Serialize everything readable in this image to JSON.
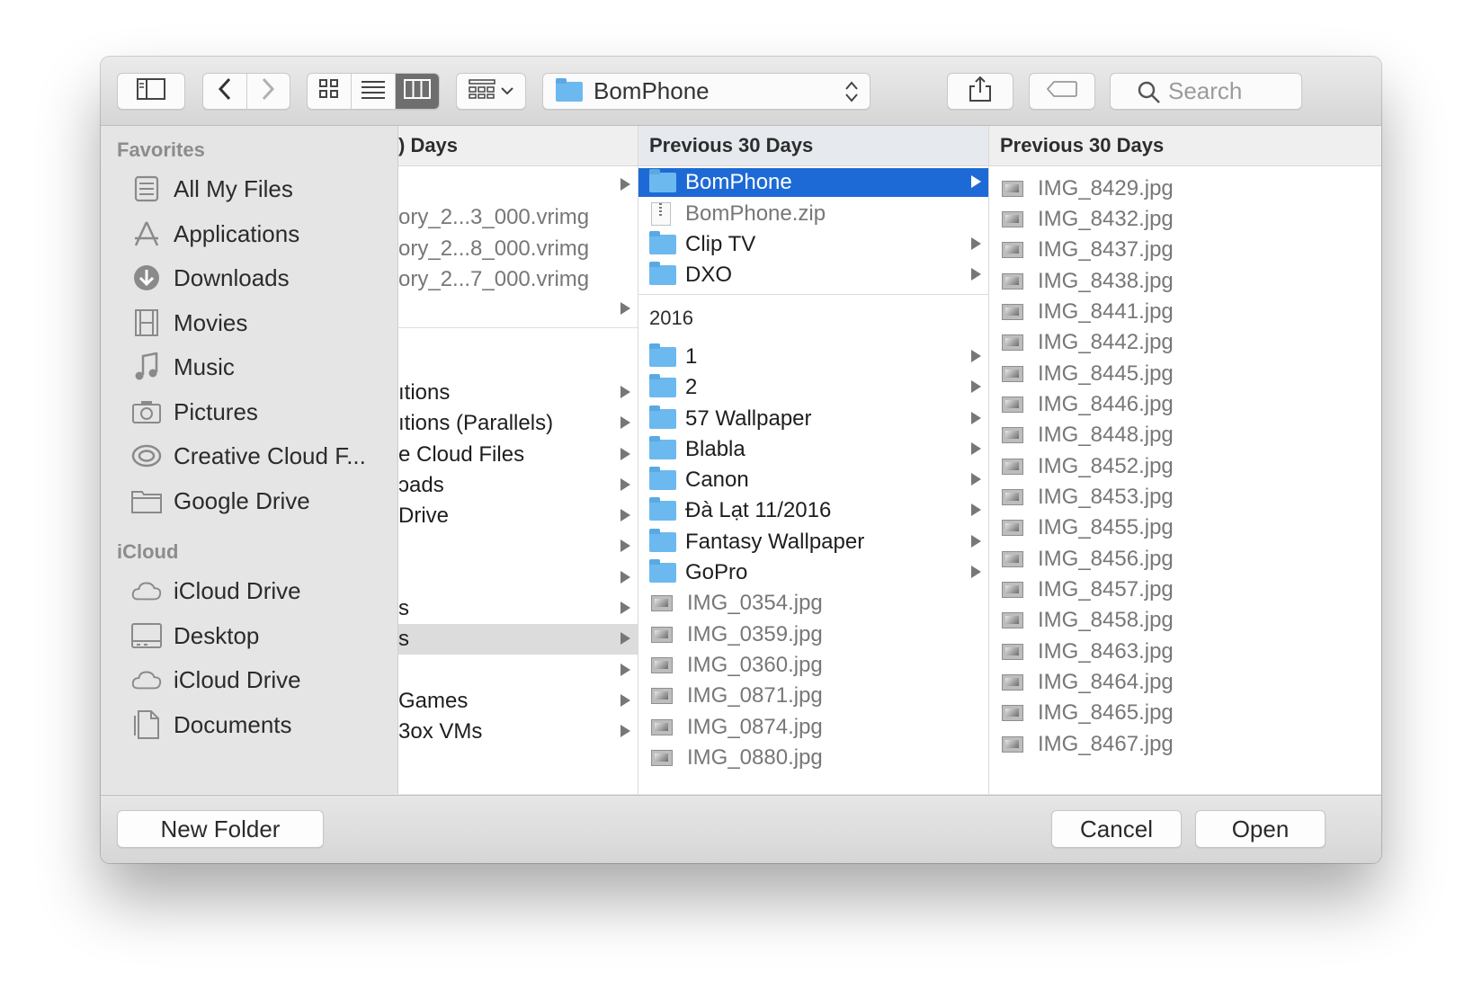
{
  "toolbar": {
    "location": "BomPhone",
    "search_placeholder": "Search"
  },
  "sidebar": {
    "favorites_heading": "Favorites",
    "favorites": [
      {
        "label": "All My Files",
        "icon": "all-files-icon"
      },
      {
        "label": "Applications",
        "icon": "applications-icon"
      },
      {
        "label": "Downloads",
        "icon": "downloads-icon"
      },
      {
        "label": "Movies",
        "icon": "movies-icon"
      },
      {
        "label": "Music",
        "icon": "music-icon"
      },
      {
        "label": "Pictures",
        "icon": "pictures-icon"
      },
      {
        "label": "Creative Cloud F...",
        "icon": "creative-cloud-icon"
      },
      {
        "label": "Google Drive",
        "icon": "folder-icon"
      }
    ],
    "icloud_heading": "iCloud",
    "icloud": [
      {
        "label": "iCloud Drive",
        "icon": "cloud-icon"
      },
      {
        "label": "Desktop",
        "icon": "desktop-icon"
      },
      {
        "label": "iCloud Drive",
        "icon": "cloud-icon"
      },
      {
        "label": "Documents",
        "icon": "documents-icon"
      }
    ]
  },
  "column1": {
    "header": ") Days",
    "items": [
      {
        "label": "",
        "arrow": true
      },
      {
        "label": "ory_2...3_000.vrimg",
        "arrow": false
      },
      {
        "label": "ory_2...8_000.vrimg",
        "arrow": false
      },
      {
        "label": "ory_2...7_000.vrimg",
        "arrow": false
      },
      {
        "label": "",
        "arrow": true
      },
      {
        "label": "ıtions",
        "arrow": true
      },
      {
        "label": "ıtions (Parallels)",
        "arrow": true
      },
      {
        "label": "e Cloud Files",
        "arrow": true
      },
      {
        "label": "ɔads",
        "arrow": true
      },
      {
        "label": " Drive",
        "arrow": true
      },
      {
        "label": "",
        "arrow": true
      },
      {
        "label": "",
        "arrow": true
      },
      {
        "label": "s",
        "arrow": true
      },
      {
        "label": "s",
        "arrow": true
      },
      {
        "label": "",
        "arrow": true
      },
      {
        "label": "Games",
        "arrow": true
      },
      {
        "label": "3ox VMs",
        "arrow": true
      }
    ]
  },
  "column2": {
    "header": "Previous 30 Days",
    "recent": [
      {
        "label": "BomPhone",
        "type": "folder",
        "selected": true
      },
      {
        "label": "BomPhone.zip",
        "type": "zip"
      },
      {
        "label": "Clip TV",
        "type": "folder"
      },
      {
        "label": "DXO",
        "type": "folder"
      }
    ],
    "section2_header": "2016",
    "items2016": [
      {
        "label": "1",
        "type": "folder"
      },
      {
        "label": "2",
        "type": "folder"
      },
      {
        "label": "57 Wallpaper",
        "type": "folder"
      },
      {
        "label": "Blabla",
        "type": "folder"
      },
      {
        "label": "Canon",
        "type": "folder"
      },
      {
        "label": "Đà Lạt 11/2016",
        "type": "folder"
      },
      {
        "label": "Fantasy Wallpaper",
        "type": "folder"
      },
      {
        "label": "GoPro",
        "type": "folder"
      },
      {
        "label": "IMG_0354.jpg",
        "type": "image"
      },
      {
        "label": "IMG_0359.jpg",
        "type": "image"
      },
      {
        "label": "IMG_0360.jpg",
        "type": "image"
      },
      {
        "label": "IMG_0871.jpg",
        "type": "image"
      },
      {
        "label": "IMG_0874.jpg",
        "type": "image"
      },
      {
        "label": "IMG_0880.jpg",
        "type": "image"
      }
    ]
  },
  "column3": {
    "header": "Previous 30 Days",
    "items": [
      "IMG_8429.jpg",
      "IMG_8432.jpg",
      "IMG_8437.jpg",
      "IMG_8438.jpg",
      "IMG_8441.jpg",
      "IMG_8442.jpg",
      "IMG_8445.jpg",
      "IMG_8446.jpg",
      "IMG_8448.jpg",
      "IMG_8452.jpg",
      "IMG_8453.jpg",
      "IMG_8455.jpg",
      "IMG_8456.jpg",
      "IMG_8457.jpg",
      "IMG_8458.jpg",
      "IMG_8463.jpg",
      "IMG_8464.jpg",
      "IMG_8465.jpg",
      "IMG_8467.jpg"
    ]
  },
  "footer": {
    "new_folder": "New Folder",
    "cancel": "Cancel",
    "open": "Open"
  }
}
